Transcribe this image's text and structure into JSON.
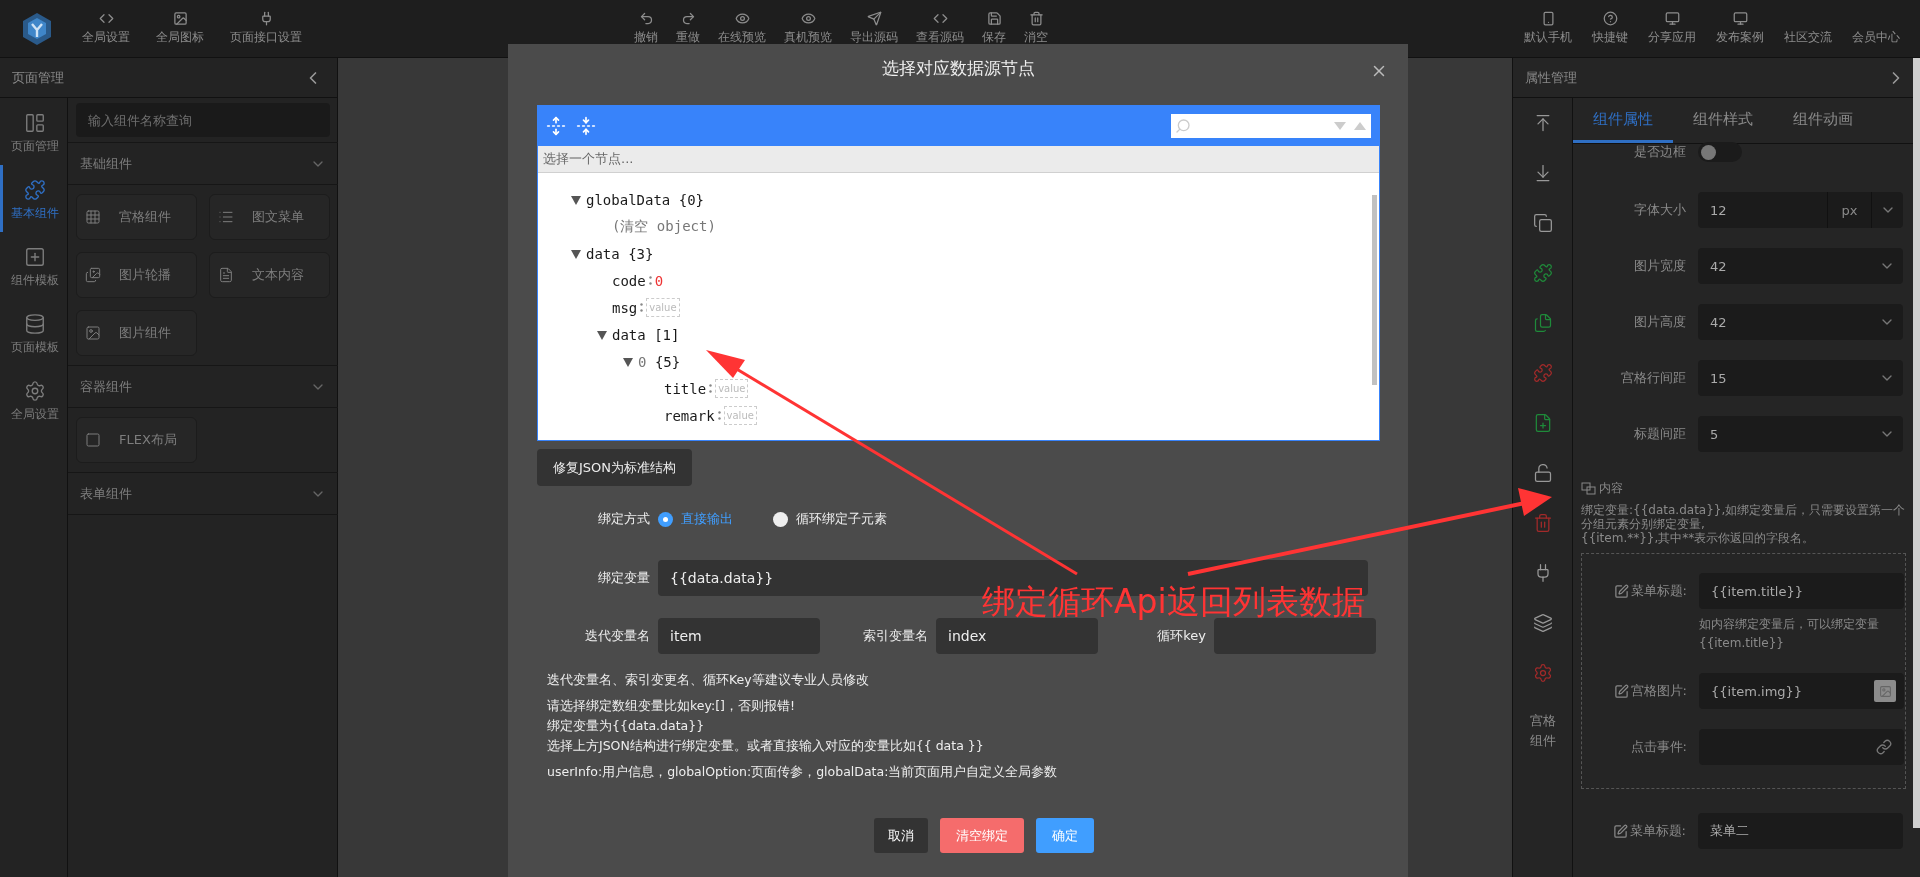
{
  "top_bar": {
    "left": [
      {
        "label": "全局设置"
      },
      {
        "label": "全局图标"
      },
      {
        "label": "页面接口设置"
      }
    ],
    "center": [
      {
        "label": "撤销"
      },
      {
        "label": "重做"
      },
      {
        "label": "在线预览"
      },
      {
        "label": "真机预览"
      },
      {
        "label": "导出源码"
      },
      {
        "label": "查看源码"
      },
      {
        "label": "保存"
      },
      {
        "label": "消空"
      }
    ],
    "right": [
      {
        "label": "默认手机",
        "kind": "icon"
      },
      {
        "label": "快捷键",
        "kind": "icon"
      },
      {
        "label": "分享应用",
        "kind": "icon"
      },
      {
        "label": "发布案例",
        "kind": "icon"
      },
      {
        "label": "社区交流",
        "kind": "text"
      },
      {
        "label": "会员中心",
        "kind": "text"
      }
    ]
  },
  "left_panel": {
    "title": "页面管理",
    "rail": [
      {
        "label": "页面管理",
        "selected": false
      },
      {
        "label": "基本组件",
        "selected": true
      },
      {
        "label": "组件模板",
        "selected": false
      },
      {
        "label": "页面模板",
        "selected": false
      },
      {
        "label": "全局设置",
        "selected": false
      }
    ],
    "search": {
      "placeholder": "输入组件名称查询"
    },
    "groups": [
      {
        "title": "基础组件",
        "items": [
          "宫格组件",
          "图文菜单",
          "图片轮播",
          "文本内容",
          "图片组件"
        ]
      },
      {
        "title": "容器组件",
        "items": [
          "FLEX布局"
        ]
      },
      {
        "title": "表单组件"
      }
    ]
  },
  "modal": {
    "title": "选择对应数据源节点",
    "tree": {
      "path_hint": "选择一个节点...",
      "nodes": [
        {
          "kind": "node",
          "key": "globalData",
          "summary": "{0}",
          "expanded": true,
          "children": [
            {
              "kind": "note",
              "text": "(清空 object)"
            }
          ]
        },
        {
          "kind": "node",
          "key": "data",
          "summary": "{3}",
          "expanded": true,
          "children": [
            {
              "kind": "number",
              "key": "code",
              "value": "0"
            },
            {
              "kind": "empty",
              "key": "msg",
              "placeholder": "value"
            },
            {
              "kind": "node",
              "key": "data",
              "summary": "[1]",
              "expanded": true,
              "children": [
                {
                  "kind": "node",
                  "key": "0",
                  "summary": "{5}",
                  "expanded": true,
                  "children": [
                    {
                      "kind": "empty",
                      "key": "title",
                      "placeholder": "value"
                    },
                    {
                      "kind": "empty",
                      "key": "remark",
                      "placeholder": "value"
                    }
                  ]
                }
              ]
            }
          ]
        }
      ]
    },
    "repair_button": "修复JSON为标准结构",
    "bind_mode": {
      "label": "绑定方式",
      "options": [
        {
          "label": "直接输出",
          "selected": true
        },
        {
          "label": "循环绑定子元素",
          "selected": false
        }
      ]
    },
    "bind_variable": {
      "label": "绑定变量",
      "value": "{{data.data}}"
    },
    "loop_fields": [
      {
        "label": "迭代变量名",
        "value": "item"
      },
      {
        "label": "索引变量名",
        "value": "index"
      },
      {
        "label": "循环key"
      }
    ],
    "notes": [
      [
        "迭代变量名、索引变更名、循环Key等建议专业人员修改"
      ],
      [
        "请选择绑定数组变量比如key:[]，否则报错!",
        "绑定变量为{{data.data}}",
        "选择上方JSON结构进行绑定变量。或者直接输入对应的变量比如{{ data }}"
      ],
      [
        "userInfo:用户信息，globalOption:页面传参，globalData:当前页面用户自定义全局参数"
      ]
    ],
    "buttons": [
      {
        "label": "取消",
        "kind": "default"
      },
      {
        "label": "清空绑定",
        "kind": "danger"
      },
      {
        "label": "确定",
        "kind": "primary"
      }
    ]
  },
  "right_panel": {
    "title": "属性管理",
    "rail_label": "宫格组件",
    "tabs": [
      {
        "label": "组件属性",
        "selected": true
      },
      {
        "label": "组件样式",
        "selected": false
      },
      {
        "label": "组件动画",
        "selected": false
      }
    ],
    "border_toggle": {
      "label": "是否边框",
      "on": false
    },
    "fields": [
      {
        "label": "字体大小",
        "value": "12",
        "unit": "px"
      },
      {
        "label": "图片宽度",
        "value": "42"
      },
      {
        "label": "图片高度",
        "value": "42"
      },
      {
        "label": "宫格行间距",
        "value": "15"
      },
      {
        "label": "标题间距",
        "value": "5"
      }
    ],
    "content_section": {
      "title": "内容",
      "description": [
        "绑定变量:{{data.data}},如绑定变量后，只需要设置第一个分组元素分别绑定变量,",
        "{{item.**}},其中**表示你返回的字段名。"
      ],
      "group": [
        {
          "kind": "text",
          "label": "菜单标题:",
          "value": "{{item.title}}",
          "hint": "如内容绑定变量后，可以绑定变量{{item.title}}"
        },
        {
          "kind": "image",
          "label": "宫格图片:",
          "value": "{{item.img}}"
        },
        {
          "kind": "link",
          "label": "点击事件:"
        }
      ],
      "after": [
        {
          "kind": "text",
          "label": "菜单标题:",
          "value": "菜单二"
        }
      ]
    }
  },
  "annotation": {
    "text": "绑定循环Api返回列表数据"
  }
}
